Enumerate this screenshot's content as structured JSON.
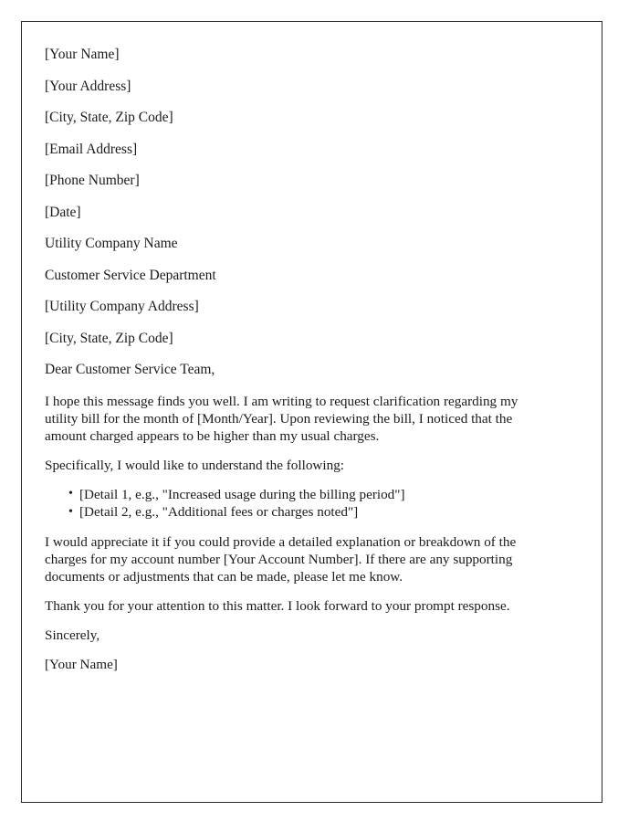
{
  "document": {
    "type": "letter",
    "sender_block": [
      "[Your Name]",
      "[Your Address]",
      "[City, State, Zip Code]",
      "[Email Address]",
      "[Phone Number]",
      "[Date]"
    ],
    "recipient_block": [
      "Utility Company Name",
      "Customer Service Department",
      "[Utility Company Address]",
      "[City, State, Zip Code]"
    ],
    "salutation": "Dear Customer Service Team,",
    "paragraphs": [
      "I hope this message finds you well. I am writing to request clarification regarding my utility bill for the month of [Month/Year]. Upon reviewing the bill, I noticed that the amount charged appears to be higher than my usual charges.",
      "Specifically, I would like to understand the following:"
    ],
    "bullets": [
      "[Detail 1, e.g., \"Increased usage during the billing period\"]",
      "[Detail 2, e.g., \"Additional fees or charges noted\"]"
    ],
    "closing_paragraphs": [
      "I would appreciate it if you could provide a detailed explanation or breakdown of the charges for my account number [Your Account Number]. If there are any supporting documents or adjustments that can be made, please let me know.",
      "Thank you for your attention to this matter. I look forward to your prompt response."
    ],
    "sign_off": "Sincerely,",
    "signature_name": "[Your Name]"
  },
  "style": {
    "text_color": "#1a1a1a",
    "border_color": "#2b2b2b",
    "background": "#ffffff"
  }
}
